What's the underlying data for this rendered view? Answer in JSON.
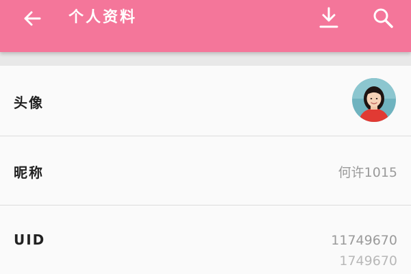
{
  "header": {
    "title": "个人资料",
    "back_icon": "arrow-left-icon",
    "download_icon": "download-icon",
    "search_icon": "search-icon",
    "background_color": "#f4769a"
  },
  "profile": {
    "avatar": {
      "label": "头像"
    },
    "nickname": {
      "label": "昵称",
      "value": "何许1015"
    },
    "uid": {
      "label": "UID",
      "value": "11749670",
      "value_echo": "1749670"
    }
  }
}
